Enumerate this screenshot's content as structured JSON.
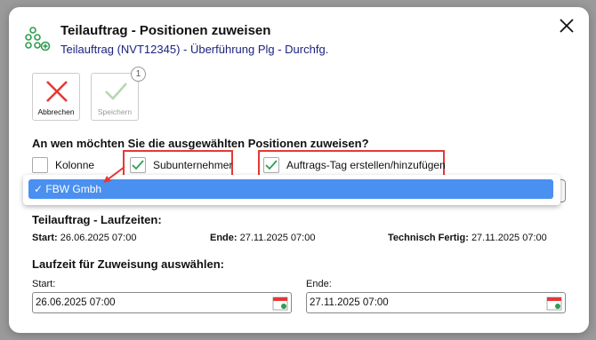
{
  "dialog": {
    "title": "Teilauftrag - Positionen zuweisen",
    "subtitle": "Teilauftrag (NVT12345) - Überführung Plg - Durchfg."
  },
  "toolbar": {
    "cancel_label": "Abbrechen",
    "save_label": "Speichern",
    "save_badge": "1"
  },
  "assign": {
    "question": "An wen möchten Sie die ausgewählten Positionen zuweisen?",
    "options": [
      {
        "label": "Kolonne",
        "checked": false
      },
      {
        "label": "Subunternehmer",
        "checked": true
      },
      {
        "label": "Auftrags-Tag erstellen/hinzufügen",
        "checked": true
      }
    ],
    "dropdown_selected": "✓ FBW Gmbh"
  },
  "runtimes": {
    "title": "Teilauftrag - Laufzeiten:",
    "start_label": "Start:",
    "start_value": "26.06.2025 07:00",
    "end_label": "Ende:",
    "end_value": "27.11.2025 07:00",
    "tech_label": "Technisch Fertig:",
    "tech_value": "27.11.2025 07:00"
  },
  "assignment_period": {
    "title": "Laufzeit für Zuweisung auswählen:",
    "start_label": "Start:",
    "start_value": "26.06.2025 07:00",
    "end_label": "Ende:",
    "end_value": "27.11.2025 07:00"
  },
  "colors": {
    "accent_green": "#2e9e4f",
    "cancel_red": "#e53935",
    "highlight_red": "#e53935",
    "selection_blue": "#4a90f0",
    "subtitle_blue": "#1a237e"
  }
}
